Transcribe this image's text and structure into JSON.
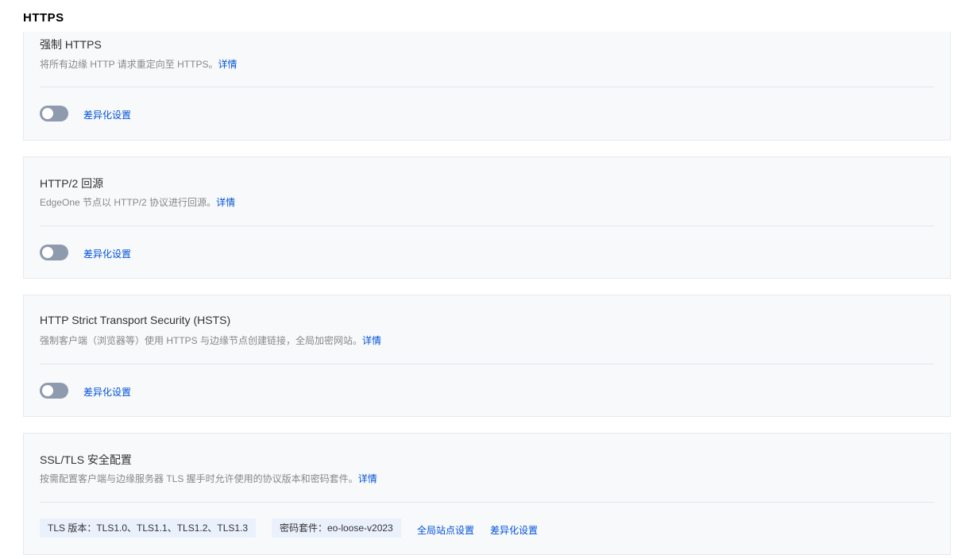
{
  "section_title": "HTTPS",
  "detail_label": "详情",
  "diff_label": "差异化设置",
  "cards": [
    {
      "title": "强制 HTTPS",
      "desc": "将所有边缘 HTTP 请求重定向至 HTTPS。",
      "enabled": false
    },
    {
      "title": "HTTP/2 回源",
      "desc": "EdgeOne 节点以 HTTP/2 协议进行回源。",
      "enabled": false
    },
    {
      "title": "HTTP Strict Transport Security (HSTS)",
      "desc": "强制客户端（浏览器等）使用 HTTPS 与边缘节点创建链接，全局加密网站。",
      "enabled": false
    },
    {
      "title": "SSL/TLS 安全配置",
      "desc": "按需配置客户端与边缘服务器 TLS 握手时允许使用的协议版本和密码套件。",
      "tls_version": "TLS 版本：TLS1.0、TLS1.1、TLS1.2、TLS1.3",
      "cipher_suite": "密码套件：eo-loose-v2023",
      "global_settings": "全局站点设置"
    }
  ],
  "colors": {
    "link": "#0052d9",
    "toggle_off": "#8e9aad",
    "card_bg": "#f8f9fb",
    "tag_bg": "#eaf1fc"
  }
}
